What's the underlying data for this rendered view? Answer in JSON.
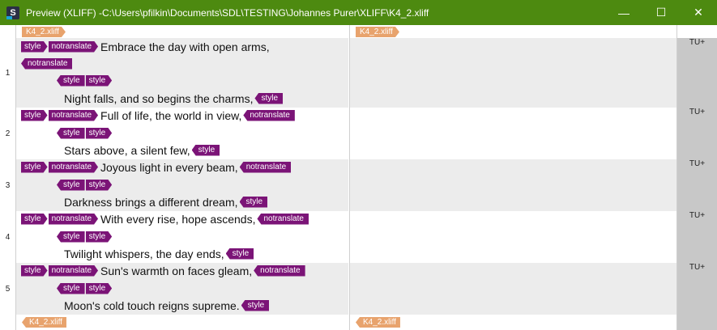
{
  "window": {
    "title": "Preview (XLIFF) -C:\\Users\\pfilkin\\Documents\\SDL\\TESTING\\Johannes Purer\\XLIFF\\K4_2.xliff",
    "app_icon_letter": "S",
    "minimize": "—",
    "maximize": "☐",
    "close": "✕"
  },
  "file_tag": "K4_2.xliff",
  "tags": {
    "style": "style",
    "notranslate": "notranslate"
  },
  "status_label": "TU+",
  "segments": [
    {
      "num": "1",
      "line1": "Embrace the day with open arms,",
      "line2": "Night falls, and so begins the charms,"
    },
    {
      "num": "2",
      "line1": "Full of life, the world in view,",
      "line2": "Stars above, a silent few,"
    },
    {
      "num": "3",
      "line1": "Joyous light in every beam,",
      "line2": "Darkness brings a different dream,"
    },
    {
      "num": "4",
      "line1": "With every rise, hope ascends,",
      "line2": "Twilight whispers, the day ends,"
    },
    {
      "num": "5",
      "line1": "Sun's warmth on faces gleam,",
      "line2": "Moon's cold touch reigns supreme."
    }
  ]
}
